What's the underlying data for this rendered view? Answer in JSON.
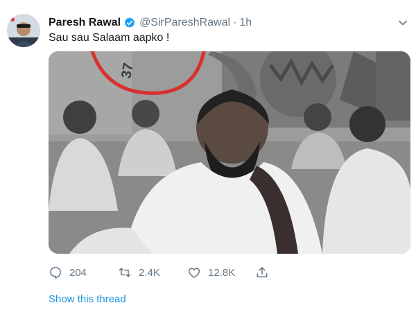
{
  "tweet": {
    "author_name": "Paresh Rawal",
    "handle": "@SirPareshRawal",
    "separator": "·",
    "time": "1h",
    "text": "Sau sau Salaam aapko !",
    "banner_text": "37"
  },
  "actions": {
    "replies": "204",
    "retweets": "2.4K",
    "likes": "12.8K"
  },
  "show_thread": "Show this thread",
  "colors": {
    "accent": "#1da1f2",
    "link": "#1b95e0",
    "muted": "#657786",
    "text": "#14171a"
  },
  "icons": [
    "verified-badge-icon",
    "chevron-down-icon",
    "reply-icon",
    "retweet-icon",
    "like-icon",
    "share-icon"
  ]
}
